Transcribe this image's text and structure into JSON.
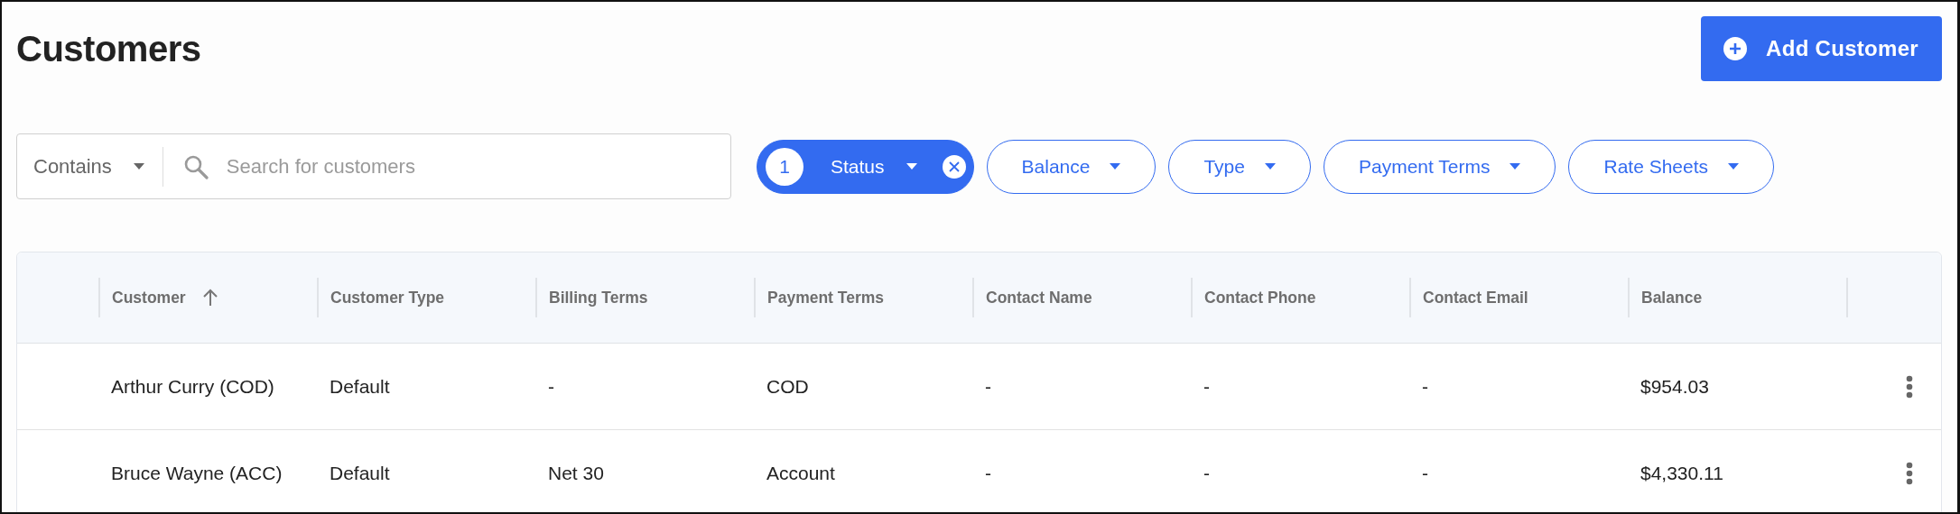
{
  "page": {
    "title": "Customers"
  },
  "add_button": {
    "label": "Add Customer"
  },
  "search": {
    "mode": "Contains",
    "placeholder": "Search for customers"
  },
  "filters": [
    {
      "label": "Status",
      "selected": true,
      "count": "1"
    },
    {
      "label": "Balance",
      "selected": false
    },
    {
      "label": "Type",
      "selected": false
    },
    {
      "label": "Payment Terms",
      "selected": false
    },
    {
      "label": "Rate Sheets",
      "selected": false
    }
  ],
  "table": {
    "columns": [
      {
        "label": "Customer",
        "sorted": true
      },
      {
        "label": "Customer Type",
        "sorted": false
      },
      {
        "label": "Billing Terms",
        "sorted": false
      },
      {
        "label": "Payment Terms",
        "sorted": false
      },
      {
        "label": "Contact Name",
        "sorted": false
      },
      {
        "label": "Contact Phone",
        "sorted": false
      },
      {
        "label": "Contact Email",
        "sorted": false
      },
      {
        "label": "Balance",
        "sorted": false
      }
    ],
    "rows": [
      {
        "cells": [
          "Arthur Curry (COD)",
          "Default",
          "-",
          "COD",
          "-",
          "-",
          "-",
          "$954.03"
        ]
      },
      {
        "cells": [
          "Bruce Wayne (ACC)",
          "Default",
          "Net 30",
          "Account",
          "-",
          "-",
          "-",
          "$4,330.11"
        ]
      }
    ]
  }
}
